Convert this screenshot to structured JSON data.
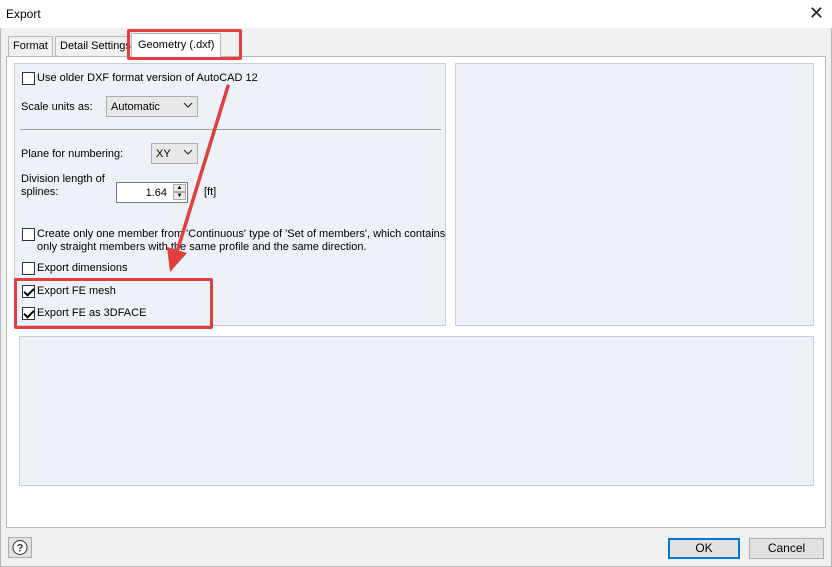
{
  "window": {
    "title": "Export",
    "close_glyph": "✕"
  },
  "tabs": [
    {
      "label": "Format"
    },
    {
      "label": "Detail Settings"
    },
    {
      "label": "Geometry (.dxf)"
    }
  ],
  "options": {
    "older_dxf": {
      "label": "Use older DXF format version of AutoCAD 12",
      "checked": false
    },
    "scale_units": {
      "label": "Scale units as:",
      "value": "Automatic"
    },
    "plane_numbering": {
      "label": "Plane for numbering:",
      "value": "XY"
    },
    "division_length": {
      "label_line1": "Division length of",
      "label_line2": "splines:",
      "value": "1.64",
      "unit": "[ft]"
    },
    "one_member": {
      "label_line1": "Create only one member from 'Continuous' type of 'Set of members', which contains",
      "label_line2": "only straight members with the same profile and the same direction.",
      "checked": false
    },
    "export_dimensions": {
      "label": "Export dimensions",
      "checked": false
    },
    "export_fe_mesh": {
      "label": "Export FE mesh",
      "checked": true
    },
    "export_fe_3dface": {
      "label": "Export FE as 3DFACE",
      "checked": true
    }
  },
  "footer": {
    "ok_label": "OK",
    "cancel_label": "Cancel"
  },
  "colors": {
    "highlight": "#e0403d",
    "panel": "#eef2f8"
  },
  "icons": {
    "help": "help-icon",
    "close": "close-icon"
  }
}
